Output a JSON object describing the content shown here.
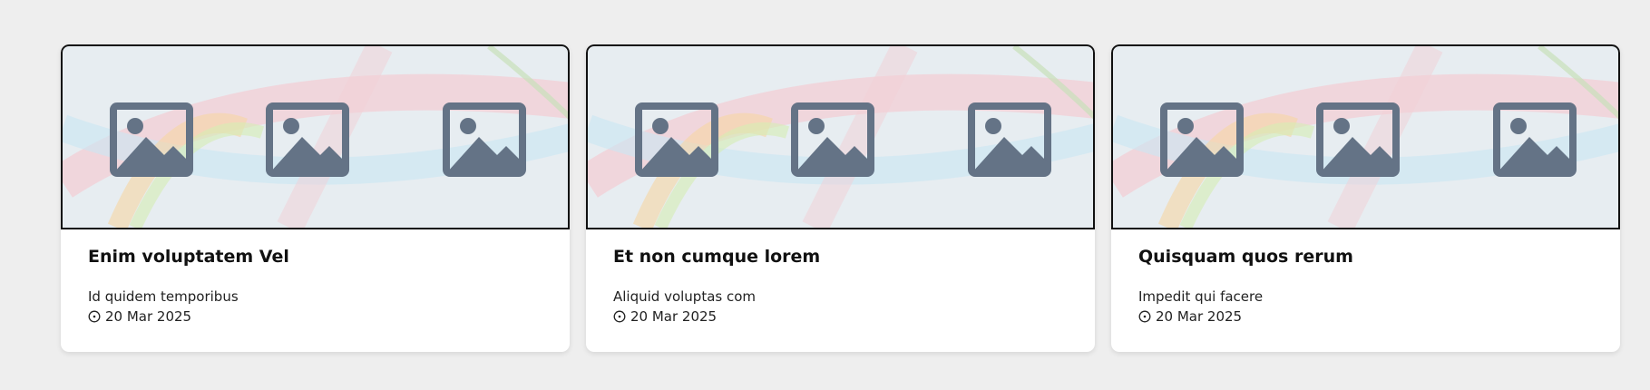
{
  "cards": [
    {
      "title": "Enim voluptatem Vel",
      "description": "Id quidem temporibus",
      "date": "20 Mar 2025",
      "image_icon": "image-placeholder-icon"
    },
    {
      "title": "Et non cumque lorem",
      "description": "Aliquid voluptas com",
      "date": "20 Mar 2025",
      "image_icon": "image-placeholder-icon"
    },
    {
      "title": "Quisquam quos rerum",
      "description": "Impedit qui facere",
      "date": "20 Mar 2025",
      "image_icon": "image-placeholder-icon"
    }
  ],
  "colors": {
    "page_background": "#eeeeee",
    "card_background": "#ffffff",
    "placeholder_icon": "#647386",
    "title_text": "#111111"
  }
}
